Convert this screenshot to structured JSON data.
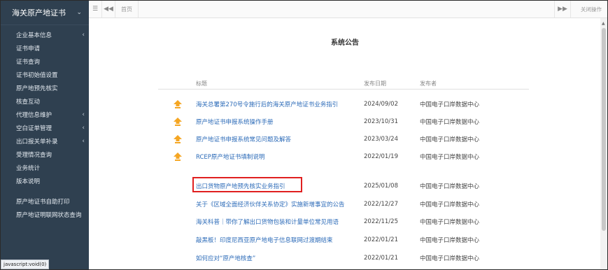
{
  "sidebar": {
    "brand": "海关原产地证书",
    "items": [
      {
        "label": "企业基本信息",
        "arrow": true
      },
      {
        "label": "证书申请",
        "arrow": false
      },
      {
        "label": "证书查询",
        "arrow": false
      },
      {
        "label": "证书初始值设置",
        "arrow": false
      },
      {
        "label": "原产地预先核实",
        "arrow": false
      },
      {
        "label": "核查互动",
        "arrow": false
      },
      {
        "label": "代理信息维护",
        "arrow": true
      },
      {
        "label": "空白证单管理",
        "arrow": true
      },
      {
        "label": "出口报关单补录",
        "arrow": true
      },
      {
        "label": "受理情况查询",
        "arrow": false
      },
      {
        "label": "业务统计",
        "arrow": false
      },
      {
        "label": "版本说明",
        "arrow": false
      }
    ],
    "items_bottom": [
      {
        "label": "原产地证书自助打印"
      },
      {
        "label": "原产地证明联网状态查询"
      }
    ],
    "status_tip": "javascript:void(0)"
  },
  "topbar": {
    "tab_home": "首页",
    "close_ops": "关闭操作"
  },
  "main": {
    "title": "系统公告",
    "columns": {
      "title": "标题",
      "date": "发布日期",
      "publisher": "发布者"
    },
    "pinned": [
      {
        "title": "海关总署第270号令施行后的海关原产地证书业务指引",
        "date": "2024/09/02",
        "publisher": "中国电子口岸数据中心"
      },
      {
        "title": "原产地证书申报系统操作手册",
        "date": "2023/10/31",
        "publisher": "中国电子口岸数据中心"
      },
      {
        "title": "原产地证书申报系统常见问题及解答",
        "date": "2023/03/24",
        "publisher": "中国电子口岸数据中心"
      },
      {
        "title": "RCEP原产地证书填制说明",
        "date": "2022/01/19",
        "publisher": "中国电子口岸数据中心"
      }
    ],
    "notices": [
      {
        "title": "出口货物原产地预先核实业务指引",
        "date": "2025/01/08",
        "publisher": "中国电子口岸数据中心"
      },
      {
        "title": "关于《区域全面经济伙伴关系协定》实施新增事宜的公告",
        "date": "2022/12/27",
        "publisher": "中国电子口岸数据中心"
      },
      {
        "title": "海关科普｜带你了解出口货物包装和计量单位常见用语",
        "date": "2022/11/25",
        "publisher": "中国电子口岸数据中心"
      },
      {
        "title": "敲黑板！印度尼西亚原产地电子信息联网过渡期结束",
        "date": "2022/01/21",
        "publisher": "中国电子口岸数据中心"
      },
      {
        "title": "如何应对“原产地核查”",
        "date": "2022/01/21",
        "publisher": "中国电子口岸数据中心"
      }
    ]
  },
  "colors": {
    "sidebar_bg": "#2f4050",
    "link": "#2c6bb8",
    "pin": "#f5a623",
    "highlight": "#e02020"
  }
}
